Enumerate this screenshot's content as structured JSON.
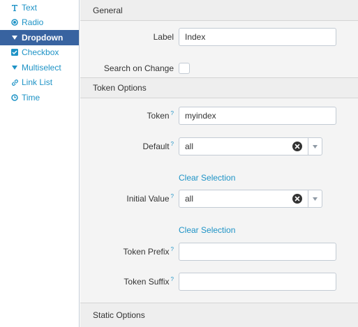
{
  "sidebar": {
    "items": [
      {
        "label": "Text",
        "icon": "text-icon"
      },
      {
        "label": "Radio",
        "icon": "radio-icon"
      },
      {
        "label": "Dropdown",
        "icon": "caret-down-icon"
      },
      {
        "label": "Checkbox",
        "icon": "checkbox-icon"
      },
      {
        "label": "Multiselect",
        "icon": "caret-down-icon"
      },
      {
        "label": "Link List",
        "icon": "link-icon"
      },
      {
        "label": "Time",
        "icon": "clock-icon"
      }
    ],
    "active_index": 2,
    "accent": "#3863a0",
    "link_color": "#1e93c6"
  },
  "general": {
    "header": "General",
    "label_label": "Label",
    "label_value": "Index",
    "search_on_change_label": "Search on Change",
    "search_on_change_checked": false
  },
  "token_options": {
    "header": "Token Options",
    "token_label": "Token",
    "token_help": "?",
    "token_value": "myindex",
    "default_label": "Default",
    "default_help": "?",
    "default_value": "all",
    "default_clear": "Clear Selection",
    "initial_label": "Initial Value",
    "initial_help": "?",
    "initial_value": "all",
    "initial_clear": "Clear Selection",
    "prefix_label": "Token Prefix",
    "prefix_help": "?",
    "prefix_value": "",
    "suffix_label": "Token Suffix",
    "suffix_help": "?",
    "suffix_value": ""
  },
  "static_options": {
    "header": "Static Options"
  }
}
